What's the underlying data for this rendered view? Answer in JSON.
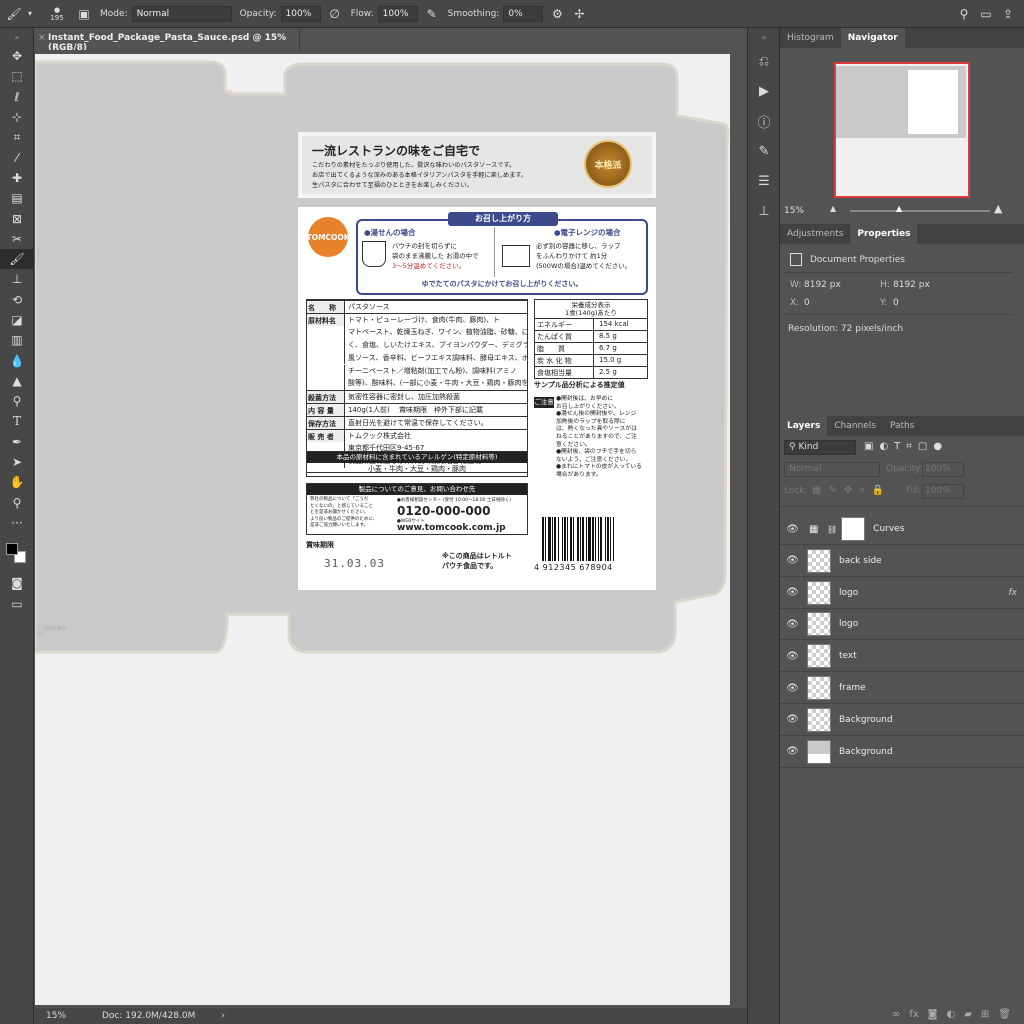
{
  "options_bar": {
    "brush_size": "195",
    "mode_label": "Mode:",
    "mode_value": "Normal",
    "opacity_label": "Opacity:",
    "opacity_value": "100%",
    "flow_label": "Flow:",
    "flow_value": "100%",
    "smoothing_label": "Smoothing:",
    "smoothing_value": "0%"
  },
  "document": {
    "tab_title": "Instant_Food_Package_Pasta_Sauce.psd @ 15% (RGB/8)",
    "close_glyph": "×"
  },
  "status_bar": {
    "zoom": "15%",
    "doc_info": "Doc: 192.0M/428.0M",
    "arrow": "›"
  },
  "panels": {
    "top_tabs": [
      "Histogram",
      "Navigator"
    ],
    "navigator_zoom": "15%",
    "mid_tabs": [
      "Adjustments",
      "Properties"
    ],
    "properties": {
      "title": "Document Properties",
      "w_label": "W:",
      "w_value": "8192 px",
      "h_label": "H:",
      "h_value": "8192 px",
      "x_label": "X:",
      "x_value": "0",
      "y_label": "Y:",
      "y_value": "0",
      "resolution": "Resolution: 72 pixels/inch"
    },
    "layer_tabs": [
      "Layers",
      "Channels",
      "Paths"
    ],
    "layers_controls": {
      "kind": "Kind",
      "blend": "Normal",
      "opacity_label": "Opacity:",
      "opacity_value": "100%",
      "lock_label": "Lock:",
      "fill_label": "Fill:",
      "fill_value": "100%"
    },
    "layers": [
      {
        "name": "Curves",
        "fx": ""
      },
      {
        "name": "back side",
        "fx": ""
      },
      {
        "name": "logo",
        "fx": "fx"
      },
      {
        "name": "logo",
        "fx": ""
      },
      {
        "name": "text",
        "fx": ""
      },
      {
        "name": "frame",
        "fx": ""
      },
      {
        "name": "Background",
        "fx": ""
      },
      {
        "name": "Background",
        "fx": ""
      }
    ]
  },
  "package": {
    "header_title": "一流レストランの味をご自宅で",
    "header_body": [
      "こだわりの素材をたっぷり使用した、贅沢な味わいのパスタソースです。",
      "お店で出てくるような深みのある本格イタリアンパスタを手軽に楽しめます。",
      "生パスタに合わせて至福のひとときをお楽しみください。"
    ],
    "seal_text": "本格派",
    "brand": "TOMCOOK",
    "howto_title": "お召し上がり方",
    "boil_title": "●湯せんの場合",
    "boil_text": [
      "パウチの封を切らずに",
      "袋のまま沸騰した お湯の中で",
      "3〜5分温めてください。"
    ],
    "micro_title": "●電子レンジの場合",
    "micro_text": [
      "必ず別の容器に移し、ラップ",
      "をふんわりかけて 約1分",
      "(500Wの場合)温めてください。"
    ],
    "howto_footer": "ゆでたてのパスタにかけてお召し上がりください。",
    "info_rows": [
      {
        "k": "名　　称",
        "v": "パスタソース"
      },
      {
        "k": "原材料名",
        "v": "トマト・ピューレーづけ、食肉(牛肉、豚肉)、ト"
      },
      {
        "k": "",
        "v": "マトペースト、乾燥玉ねぎ、ワイン、植物油脂、砂糖、にんに"
      },
      {
        "k": "",
        "v": "く、食塩、しいたけエキス、ブイヨンパウダー、デミグラス"
      },
      {
        "k": "",
        "v": "風ソース、香辛料、ビーフエキス調味料、酵母エキス、ポル"
      },
      {
        "k": "",
        "v": "チーニペースト／増粘剤(加工でん粉)、調味料(アミノ"
      },
      {
        "k": "",
        "v": "酸等)、酸味料、(一部に小麦・牛肉・大豆・鶏肉・豚肉を含む)"
      },
      {
        "k": "殺菌方法",
        "v": "気密性容器に密封し、加圧加熱殺菌"
      },
      {
        "k": "内 容 量",
        "v": "140g(1人前)　 賞味期限　枠外下部に記載"
      },
      {
        "k": "保存方法",
        "v": "直射日光を避けて常温で保存してください。"
      },
      {
        "k": "販 売 者",
        "v": "トムクック株式会社"
      },
      {
        "k": "",
        "v": "東京都千代田区9-45-67"
      },
      {
        "k": "",
        "v": "製造所固有記号は枠外賞味期限右部に記載"
      }
    ],
    "nutrition_title": "栄養成分表示",
    "nutrition_sub": "1食(140g)あたり",
    "nutrition": [
      {
        "k": "エネルギー",
        "v": "154 kcal"
      },
      {
        "k": "たんぱく質",
        "v": "8.5 g"
      },
      {
        "k": "脂　　質",
        "v": "6.7 g"
      },
      {
        "k": "炭 水 化 物",
        "v": "15.0 g"
      },
      {
        "k": "食塩相当量",
        "v": "2.5 g"
      }
    ],
    "nutrition_note": "サンプル品分析による推定値",
    "caution_label": "ご注意",
    "caution_text": [
      "●開封後は、お早めに",
      "お召し上がりください。",
      "●湯せん後の開封後や、レンジ",
      "加熱後のラップを取る際に",
      "は、熱くなった具やソースがは",
      "ねることがありますので、ご注",
      "意ください。",
      "●開封後、袋のフチで手を切ら",
      "ないよう、ご注意ください。",
      "●まれにトマトの皮が入っている",
      "場合があります。"
    ],
    "allergen_title": "本品の原材料に含まれているアレルゲン(特定原材料等)",
    "allergen_list": "小麦・牛肉・大豆・鶏肉・豚肉",
    "contact_title": "製品についてのご意見、お問い合わせ先",
    "contact_left": [
      "弊社の製品について「ごうだ",
      "たくないの」と感じていること",
      "とを是非お聞かせください。",
      "より良い製品のご提供のために、",
      "是非ご協力願いいたします。"
    ],
    "contact_center": "●お客様相談センター (受付 10:00〜18:00 土日祝除く)",
    "phone": "0120-000-000",
    "web_label": "●WEBサイト",
    "url": "www.tomcook.com.jp",
    "expiry_label": "賞味期限",
    "expiry_date": "31.03.03",
    "retort_note": [
      "※この商品はレトルト",
      "パウチ食品です。"
    ],
    "barcode_number": "4 912345 678904",
    "side_tiny": [
      "しの部分後の",
      "5%"
    ]
  }
}
